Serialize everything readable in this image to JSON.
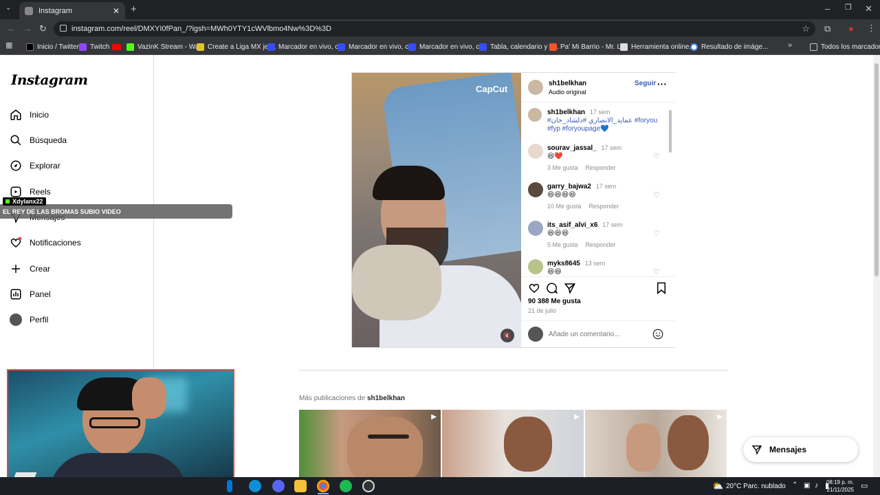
{
  "browser": {
    "tab_title": "Instagram",
    "url": "instagram.com/reel/DMXYI0fPan_/?igsh=MWh0YTY1cWVlbmo4Nw%3D%3D",
    "bookmarks": [
      "Inicio / Twitter",
      "Twitch",
      "",
      "VazinK Stream - Wa...",
      "Create a Liga MX jer...",
      "Marcador en vivo, c...",
      "Marcador en vivo, c...",
      "Marcador en vivo, c...",
      "Tabla, calendario y e...",
      "Pa' Mi Barrio - Mr. L...",
      "Herramienta online...",
      "Resultado de imáge..."
    ],
    "all_bookmarks": "Todos los marcadores"
  },
  "sidebar": {
    "logo": "Instagram",
    "items": [
      "Inicio",
      "Búsqueda",
      "Explorar",
      "Reels",
      "Mensajes",
      "Notificaciones",
      "Crear",
      "Panel",
      "Perfil"
    ]
  },
  "overlay": {
    "tag": "Xdylanx22",
    "banner": "EL REY DE LAS BROMAS SUBIO VIDEO"
  },
  "post": {
    "watermark": "CapCut",
    "author": "sh1belkhan",
    "audio": "Audio original",
    "follow": "Seguir",
    "caption": {
      "user": "sh1belkhan",
      "time": "17 sem",
      "line1": "#عمايد_الانصاري #دلشاد_خان #foryou",
      "line2": "#fyp #foryoupage💙"
    },
    "comments": [
      {
        "user": "sourav_jassal_",
        "time": "17 sem",
        "text": "😆❤️",
        "likes": "3 Me gusta",
        "reply": "Responder"
      },
      {
        "user": "garry_bajwa2",
        "time": "17 sem",
        "text": "😆😆😆😆",
        "likes": "10 Me gusta",
        "reply": "Responder"
      },
      {
        "user": "its_asif_alvi_x6",
        "time": "17 sem",
        "text": "😆😆😆",
        "likes": "5 Me gusta",
        "reply": "Responder"
      },
      {
        "user": "myks8645",
        "time": "13 sem",
        "text": "😆😆",
        "likes": "",
        "reply": ""
      }
    ],
    "like_count": "90 388 Me gusta",
    "date": "21 de julio",
    "comment_placeholder": "Añade un comentario..."
  },
  "more": {
    "prefix": "Más publicaciones de ",
    "user": "sh1belkhan"
  },
  "messages_pill": "Mensajes",
  "taskbar": {
    "weather": "20°C  Parc. nublado",
    "time": "08:19 p. m.",
    "date": "21/11/2025"
  }
}
